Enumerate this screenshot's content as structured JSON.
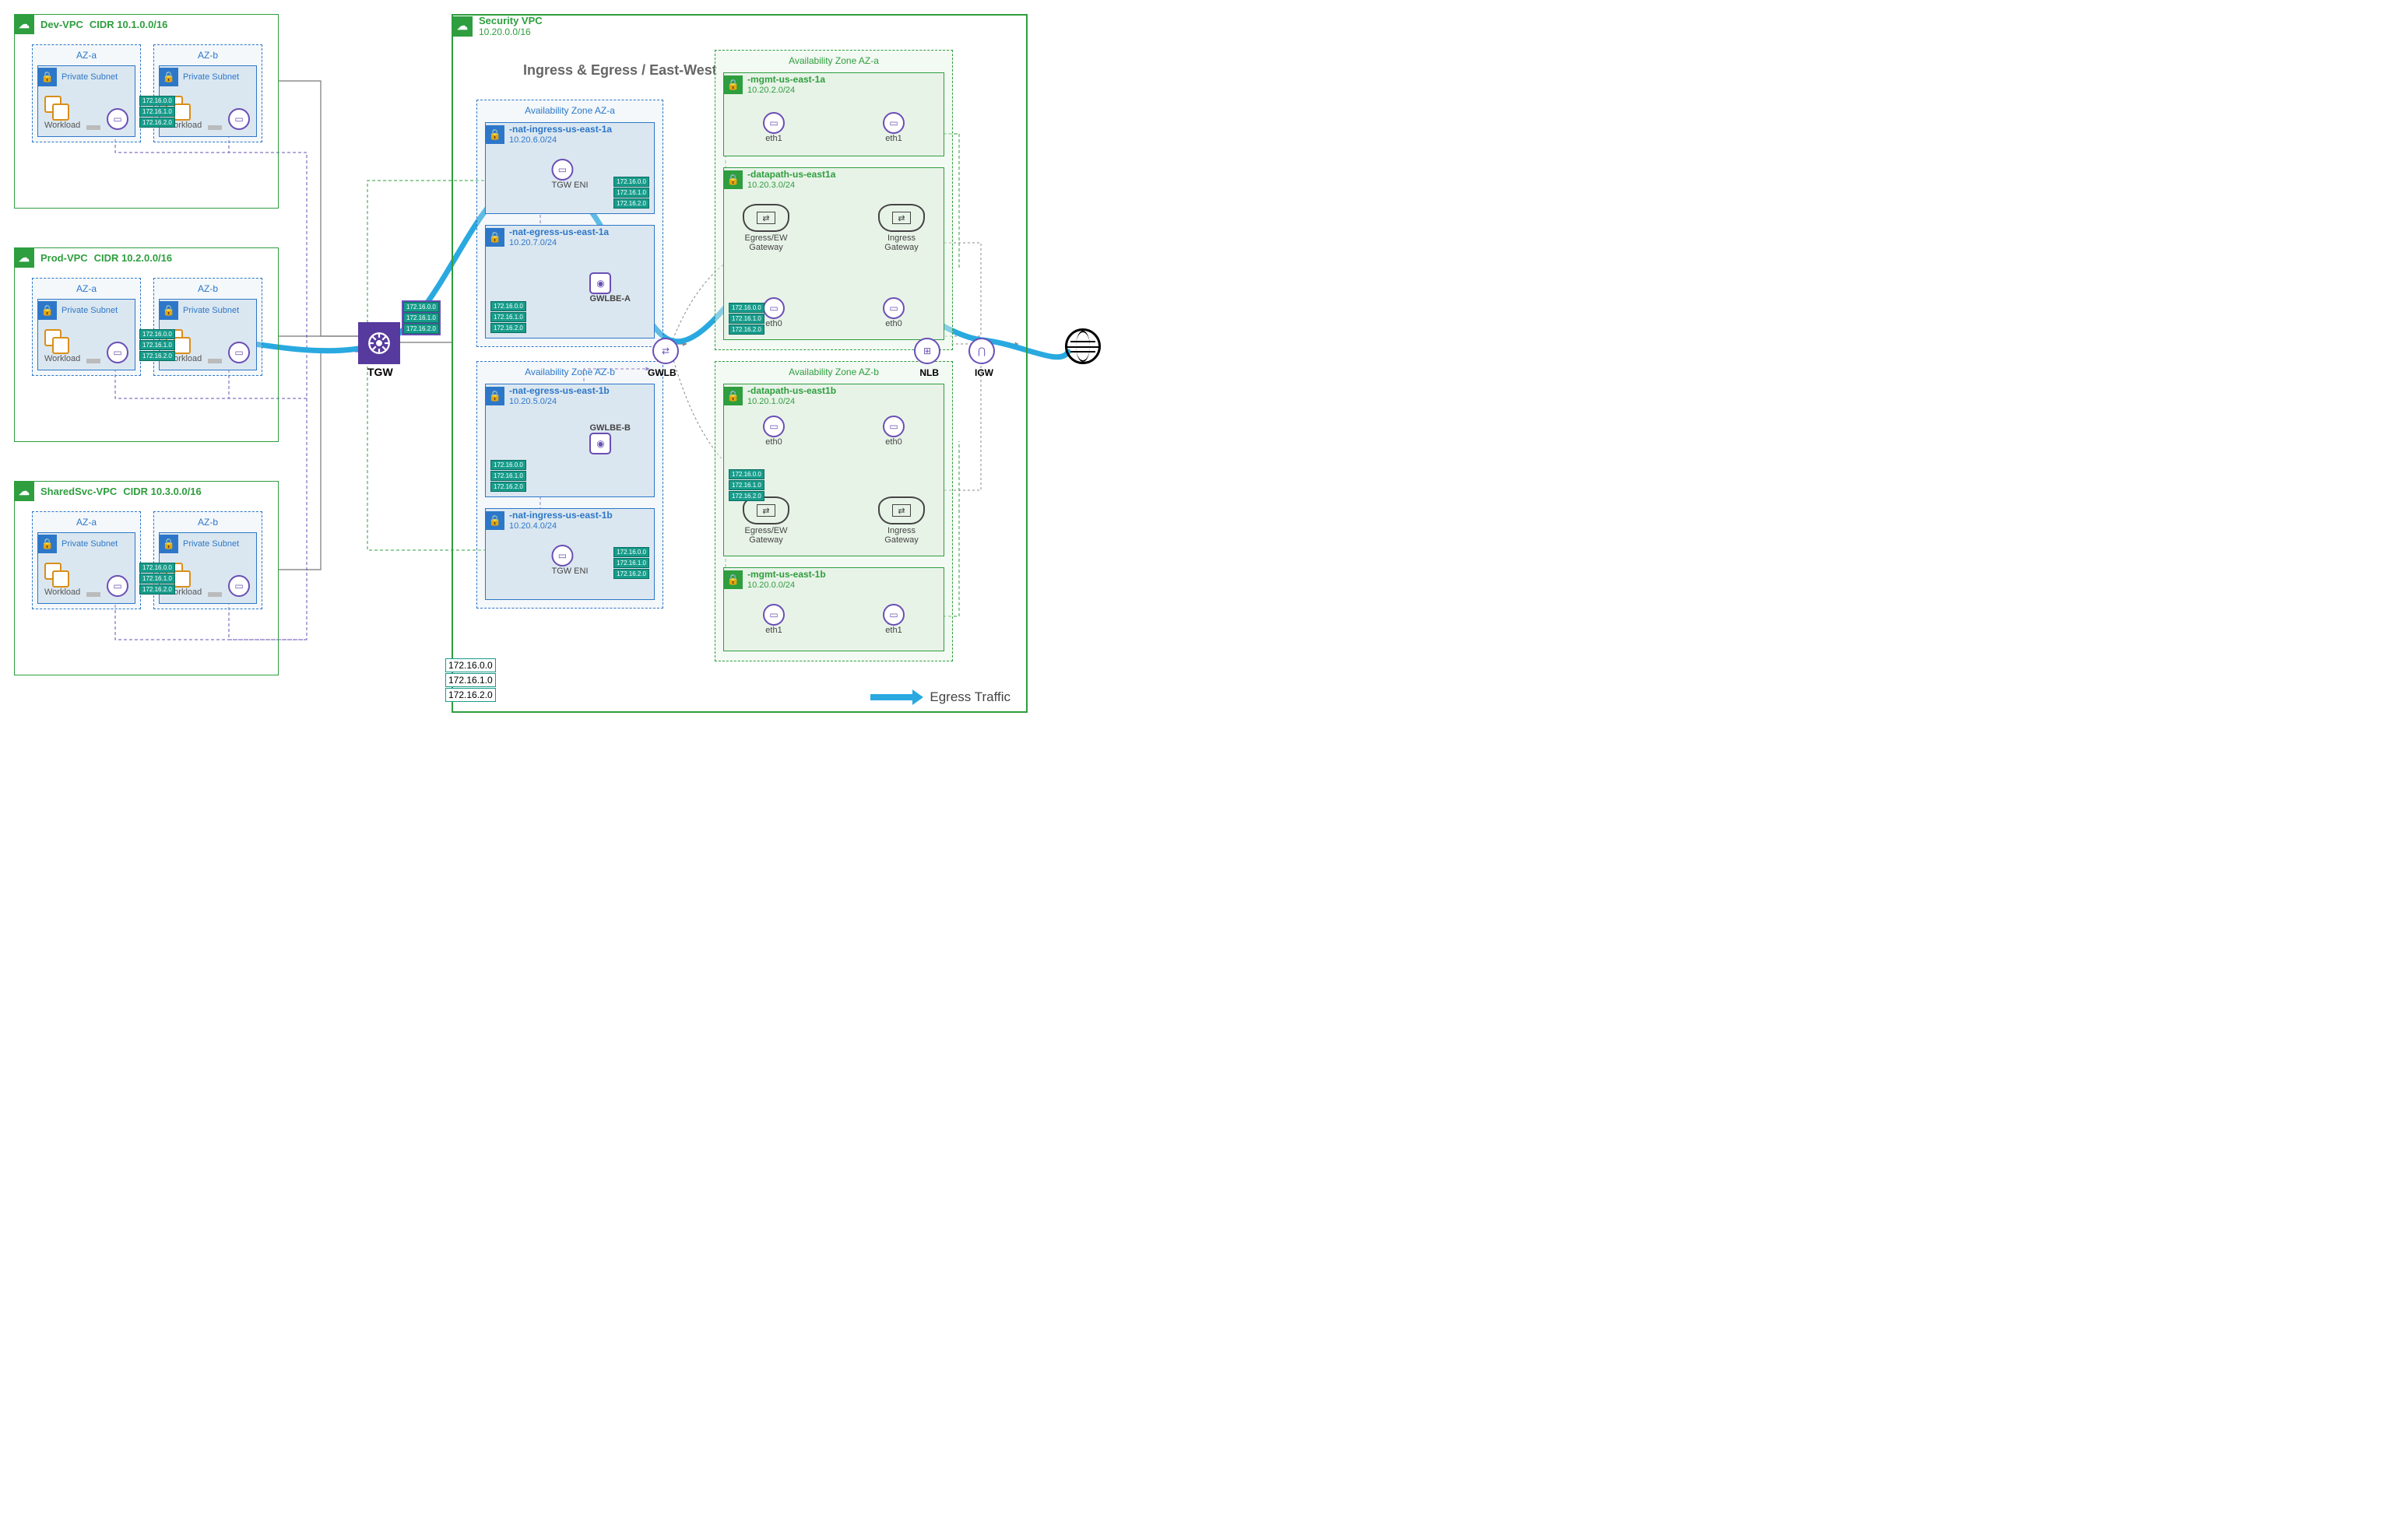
{
  "vpcs": {
    "dev": {
      "name": "Dev-VPC",
      "cidr_label": "CIDR 10.1.0.0/16"
    },
    "prod": {
      "name": "Prod-VPC",
      "cidr_label": "CIDR 10.2.0.0/16"
    },
    "shared": {
      "name": "SharedSvc-VPC",
      "cidr_label": "CIDR 10.3.0.0/16"
    },
    "security": {
      "name": "Security VPC",
      "cidr": "10.20.0.0/16"
    }
  },
  "workload_az": {
    "a_title": "AZ-a",
    "b_title": "AZ-b"
  },
  "subnet_label": "Private Subnet",
  "workload_label": "Workload",
  "route_tags_small": [
    "172.16.0.0",
    "172.16.1.0",
    "172.16.2.0"
  ],
  "route_tags_big": [
    "172.16.0.0",
    "172.16.1.0",
    "172.16.2.0"
  ],
  "tgw_label": "TGW",
  "section_title": "Ingress & Egress / East-West",
  "sec_az": {
    "a_blue_title": "Availability Zone AZ-a",
    "b_blue_title": "Availability Zone AZ-b",
    "a_green_title": "Availability Zone AZ-a",
    "b_green_title": "Availability Zone AZ-b"
  },
  "sec_subnets": {
    "nat_ingress_a": {
      "name": "-nat-ingress-us-east-1a",
      "cidr": "10.20.6.0/24",
      "eni_label": "TGW ENI"
    },
    "nat_egress_a": {
      "name": "-nat-egress-us-east-1a",
      "cidr": "10.20.7.0/24",
      "gwlbe_label": "GWLBE-A"
    },
    "nat_egress_b": {
      "name": "-nat-egress-us-east-1b",
      "cidr": "10.20.5.0/24",
      "gwlbe_label": "GWLBE-B"
    },
    "nat_ingress_b": {
      "name": "-nat-ingress-us-east-1b",
      "cidr": "10.20.4.0/24",
      "eni_label": "TGW ENI"
    },
    "mgmt_a": {
      "name": "-mgmt-us-east-1a",
      "cidr": "10.20.2.0/24"
    },
    "datapath_a": {
      "name": "-datapath-us-east1a",
      "cidr": "10.20.3.0/24"
    },
    "datapath_b": {
      "name": "-datapath-us-east1b",
      "cidr": "10.20.1.0/24"
    },
    "mgmt_b": {
      "name": "-mgmt-us-east-1b",
      "cidr": "10.20.0.0/24"
    }
  },
  "eth": {
    "eth0": "eth0",
    "eth1": "eth1"
  },
  "gateways": {
    "egress": "Egress/EW\nGateway",
    "ingress": "Ingress\nGateway"
  },
  "nodes": {
    "gwlb": "GWLB",
    "nlb": "NLB",
    "igw": "IGW"
  },
  "legend": "Egress Traffic"
}
